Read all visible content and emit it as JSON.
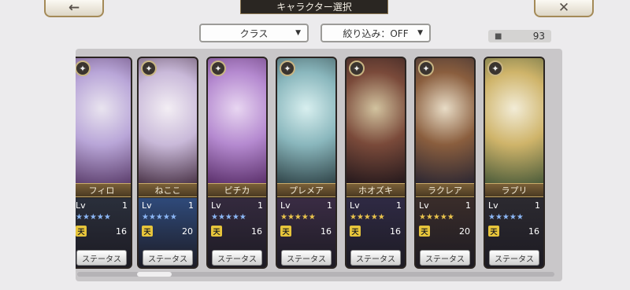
{
  "header": {
    "title": "キャラクター選択",
    "back_icon": "←",
    "close_icon": "✕"
  },
  "filters": {
    "class_label": "クラス",
    "filter_label": "絞り込み：OFF",
    "arrow": "▼"
  },
  "count": {
    "icon": "user-icon",
    "value": "93"
  },
  "status_label": "ステータス",
  "cards": [
    {
      "name": "フィロ",
      "lv_label": "Lv",
      "lv": "1",
      "stars": "★★★★★",
      "rank_icon": "天",
      "rank": "16",
      "star_color": "#8bb6f5",
      "bg": [
        "#e9e4ef",
        "#b9a6d8",
        "#5b3d6b"
      ]
    },
    {
      "name": "ねここ",
      "lv_label": "Lv",
      "lv": "1",
      "stars": "★★★★★",
      "rank_icon": "天",
      "rank": "20",
      "star_color": "#8bb6f5",
      "bg": [
        "#f3eef4",
        "#c9b9d9",
        "#4a3347"
      ]
    },
    {
      "name": "ピチカ",
      "lv_label": "Lv",
      "lv": "1",
      "stars": "★★★★★",
      "rank_icon": "天",
      "rank": "16",
      "star_color": "#8bb6f5",
      "bg": [
        "#e8d6f1",
        "#b58ad0",
        "#5a2f6a"
      ]
    },
    {
      "name": "プレメア",
      "lv_label": "Lv",
      "lv": "1",
      "stars": "★★★★★",
      "rank_icon": "天",
      "rank": "16",
      "star_color": "#e9c34c",
      "bg": [
        "#d8efef",
        "#8ab7bd",
        "#2f4347"
      ]
    },
    {
      "name": "ホオズキ",
      "lv_label": "Lv",
      "lv": "1",
      "stars": "★★★★★",
      "rank_icon": "天",
      "rank": "16",
      "star_color": "#e9c34c",
      "bg": [
        "#d2c39f",
        "#7a4a3a",
        "#23181c"
      ]
    },
    {
      "name": "ラクレア",
      "lv_label": "Lv",
      "lv": "1",
      "stars": "★★★★★",
      "rank_icon": "天",
      "rank": "20",
      "star_color": "#e9c34c",
      "bg": [
        "#e8dcc6",
        "#8a5e3e",
        "#2a2632"
      ]
    },
    {
      "name": "ラプリ",
      "lv_label": "Lv",
      "lv": "1",
      "stars": "★★★★★",
      "rank_icon": "天",
      "rank": "16",
      "star_color": "#8bb6f5",
      "bg": [
        "#f2ecd7",
        "#cfb46a",
        "#4a5b3a"
      ]
    }
  ],
  "lower_bgs": [
    "#2a2f3b",
    "#2f4a7a",
    "#342a3e",
    "#3a2c44",
    "#2f2a44",
    "#3a2d2a",
    "#2c2a30"
  ]
}
